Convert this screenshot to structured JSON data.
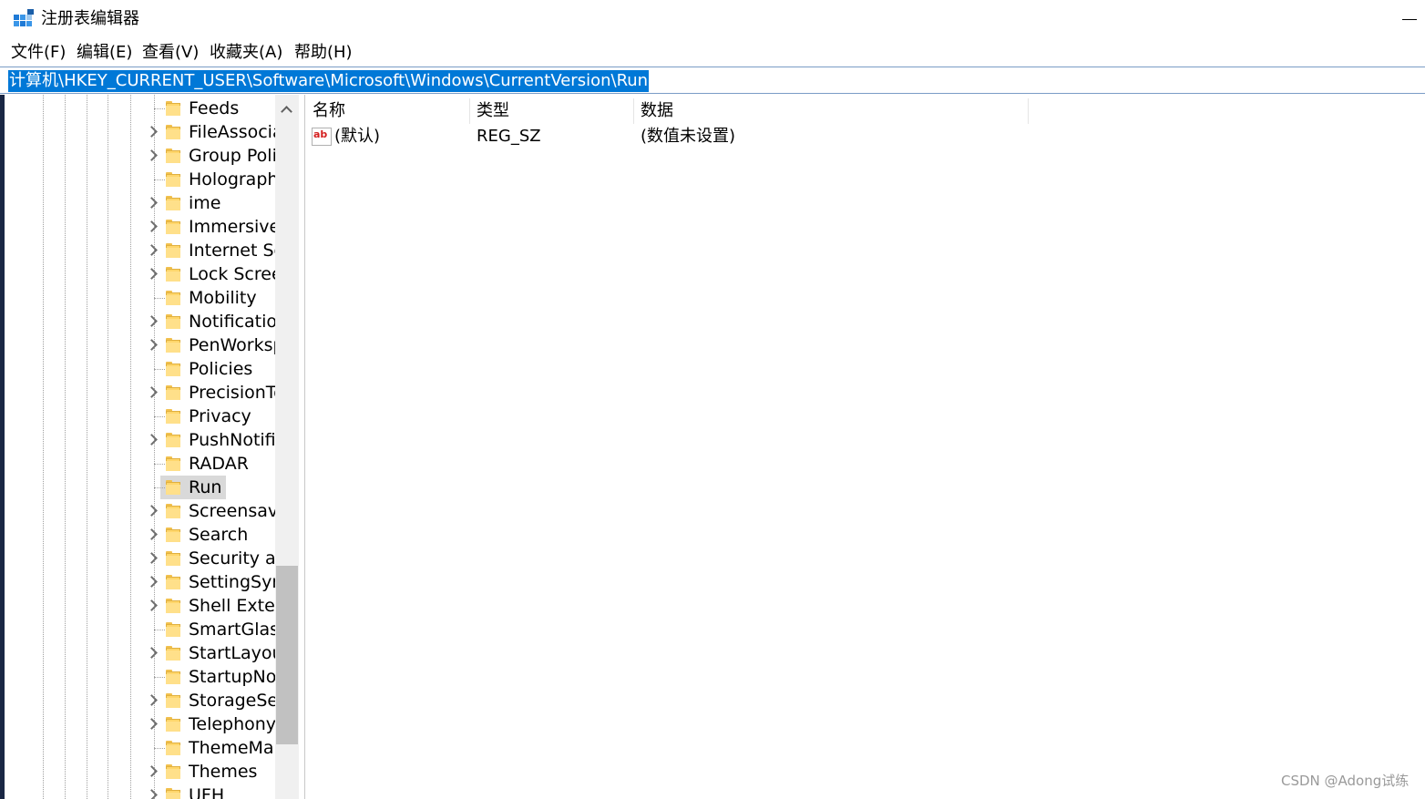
{
  "window": {
    "title": "注册表编辑器"
  },
  "menu": [
    "文件(F)",
    "编辑(E)",
    "查看(V)",
    "收藏夹(A)",
    "帮助(H)"
  ],
  "address": "计算机\\HKEY_CURRENT_USER\\Software\\Microsoft\\Windows\\CurrentVersion\\Run",
  "tree": {
    "items": [
      {
        "label": "Feeds",
        "expandable": false
      },
      {
        "label": "FileAssocia",
        "expandable": true
      },
      {
        "label": "Group Polic",
        "expandable": true
      },
      {
        "label": "Holograph",
        "expandable": false
      },
      {
        "label": "ime",
        "expandable": true
      },
      {
        "label": "ImmersiveS",
        "expandable": true
      },
      {
        "label": "Internet Se",
        "expandable": true
      },
      {
        "label": "Lock Screen",
        "expandable": true
      },
      {
        "label": "Mobility",
        "expandable": false
      },
      {
        "label": "Notification",
        "expandable": true
      },
      {
        "label": "PenWorksp",
        "expandable": true
      },
      {
        "label": "Policies",
        "expandable": false
      },
      {
        "label": "PrecisionTo",
        "expandable": true
      },
      {
        "label": "Privacy",
        "expandable": false
      },
      {
        "label": "PushNotific",
        "expandable": true
      },
      {
        "label": "RADAR",
        "expandable": false
      },
      {
        "label": "Run",
        "expandable": false,
        "selected": true
      },
      {
        "label": "Screensave",
        "expandable": true
      },
      {
        "label": "Search",
        "expandable": true
      },
      {
        "label": "Security an",
        "expandable": true
      },
      {
        "label": "SettingSyn",
        "expandable": true
      },
      {
        "label": "Shell Exten",
        "expandable": true
      },
      {
        "label": "SmartGlass",
        "expandable": false
      },
      {
        "label": "StartLayout",
        "expandable": true
      },
      {
        "label": "StartupNot",
        "expandable": false
      },
      {
        "label": "StorageSer",
        "expandable": true
      },
      {
        "label": "Telephony",
        "expandable": true
      },
      {
        "label": "ThemeMar",
        "expandable": false
      },
      {
        "label": "Themes",
        "expandable": true
      },
      {
        "label": "UFH",
        "expandable": true
      }
    ]
  },
  "values": {
    "columns": [
      "名称",
      "类型",
      "数据"
    ],
    "rows": [
      {
        "name": "(默认)",
        "type": "REG_SZ",
        "data": "(数值未设置)",
        "icon": "string-value-icon"
      }
    ]
  },
  "watermark": "CSDN @Adong试练",
  "colors": {
    "selection": "#0078d7",
    "folder": "#ffd66b",
    "tree_selected": "#d9d9d9"
  }
}
